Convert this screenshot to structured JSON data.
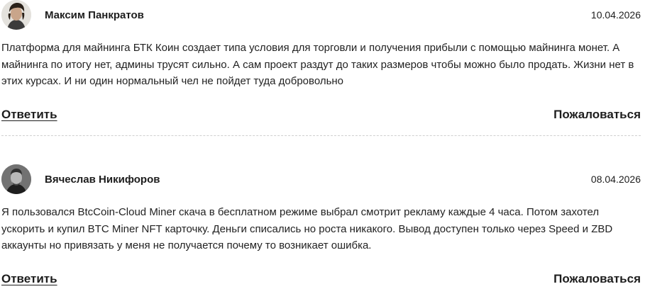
{
  "comments": [
    {
      "author": "Максим Панкратов",
      "date": "10.04.2026",
      "text": "Платформа для майнинга БТК Коин создает типа условия для торговли и получения прибыли с помощью майнинга монет. А майнинга по итогу нет, админы трусят сильно. А сам проект раздут до таких размеров чтобы можно было продать. Жизни нет в этих курсах. И ни один нормальный чел не пойдет туда добровольно",
      "reply_label": "Ответить",
      "report_label": "Пожаловаться",
      "avatar_icon": "user-photo-avatar"
    },
    {
      "author": "Вячеслав Никифоров",
      "date": "08.04.2026",
      "text": "Я пользовался BtcCoin-Cloud Miner скача в бесплатном режиме выбрал смотрит рекламу каждые 4 часа. Потом захотел ускорить и купил BTC Miner NFT карточку. Деньги списались но роста никакого. Вывод доступен только через Speed и ZBD аккаунты но привязать у меня не получается почему то возникает ошибка.",
      "reply_label": "Ответить",
      "report_label": "Пожаловаться",
      "avatar_icon": "user-photo-avatar"
    }
  ]
}
